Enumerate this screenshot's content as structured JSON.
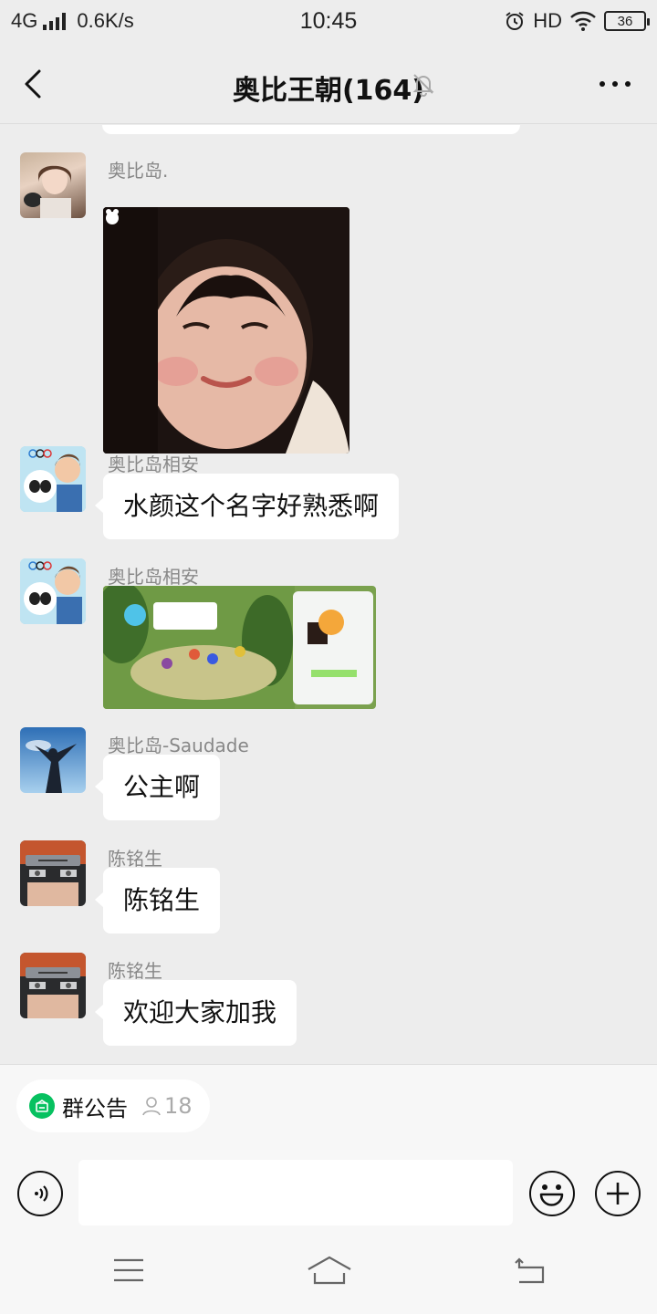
{
  "status_bar": {
    "network": "4G",
    "speed": "0.6K/s",
    "time": "10:45",
    "hd": "HD",
    "battery": "36"
  },
  "header": {
    "title": "奥比王朝(164)",
    "muted": true
  },
  "messages": [
    {
      "sender": "奥比岛.",
      "type": "image",
      "image_desc": "girl-face-photo"
    },
    {
      "sender": "奥比岛相安",
      "type": "text",
      "text": "水颜这个名字好熟悉啊"
    },
    {
      "sender": "奥比岛相安",
      "type": "image",
      "image_desc": "game-screenshot"
    },
    {
      "sender": "奥比岛-Saudade",
      "type": "text",
      "text": "公主啊"
    },
    {
      "sender": "陈铭生",
      "type": "text",
      "text": "陈铭生"
    },
    {
      "sender": "陈铭生",
      "type": "text",
      "text": "欢迎大家加我"
    }
  ],
  "notice": {
    "label": "群公告",
    "count": "18",
    "accent": "#07c160"
  },
  "input": {
    "value": "",
    "placeholder": ""
  }
}
